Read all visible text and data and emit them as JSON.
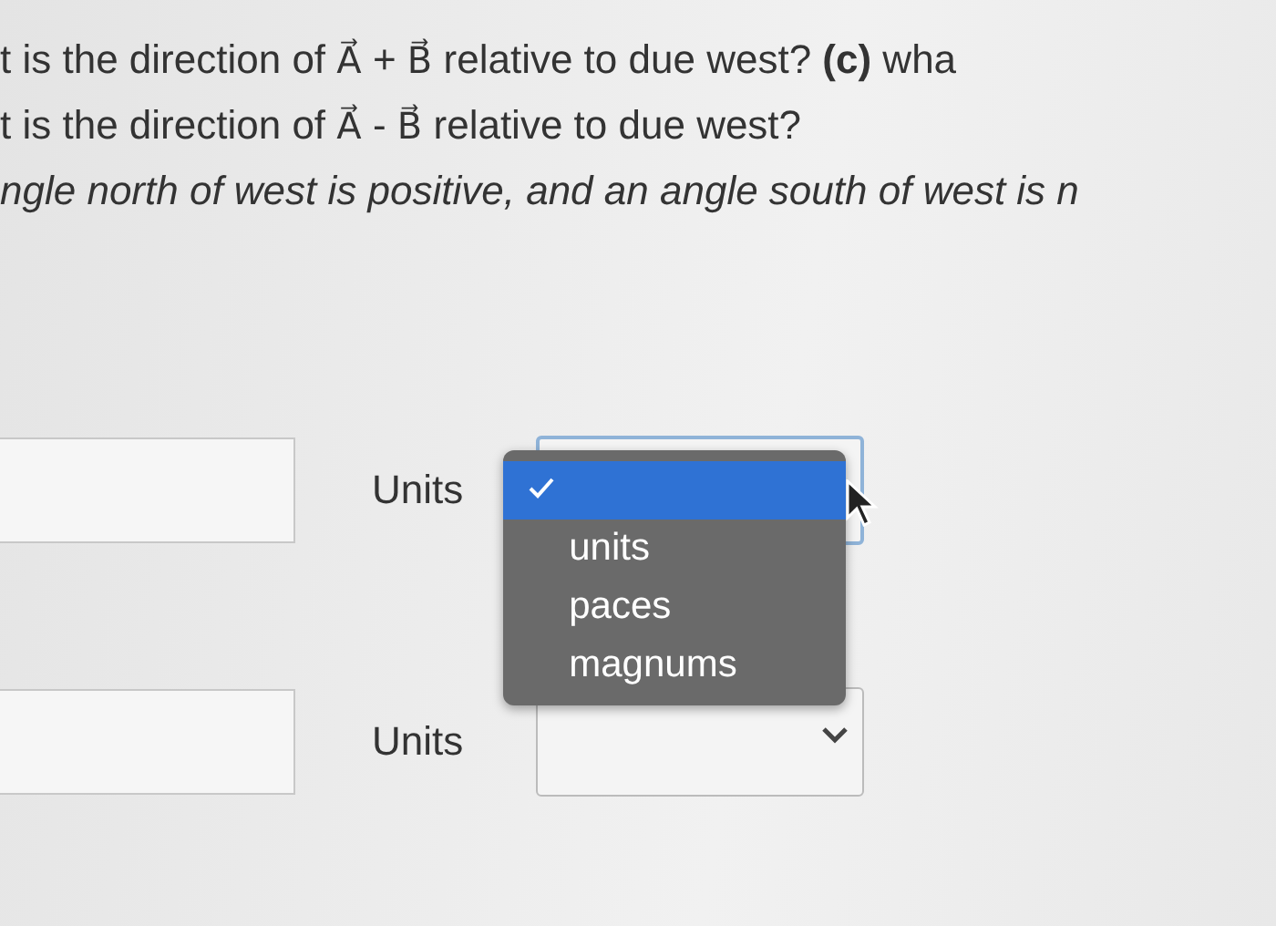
{
  "question_lines": [
    {
      "text": "t is the direction of A⃗ + B⃗ relative to due west? **(c)** wha",
      "italic": false
    },
    {
      "text": "t is the direction of A⃗ - B⃗ relative to due west?",
      "italic": false
    },
    {
      "text": "ngle north of west is positive, and an angle south of west is n",
      "italic": true
    }
  ],
  "answers": [
    {
      "units_label": "Units",
      "select": {
        "expanded": true,
        "options": [
          {
            "selected": true
          },
          {
            "label": "units",
            "selected": false
          },
          {
            "label": "paces",
            "selected": false
          },
          {
            "label": "magnums",
            "selected": false
          }
        ]
      }
    },
    {
      "units_label": "Units",
      "select": {
        "expanded": false
      }
    }
  ]
}
